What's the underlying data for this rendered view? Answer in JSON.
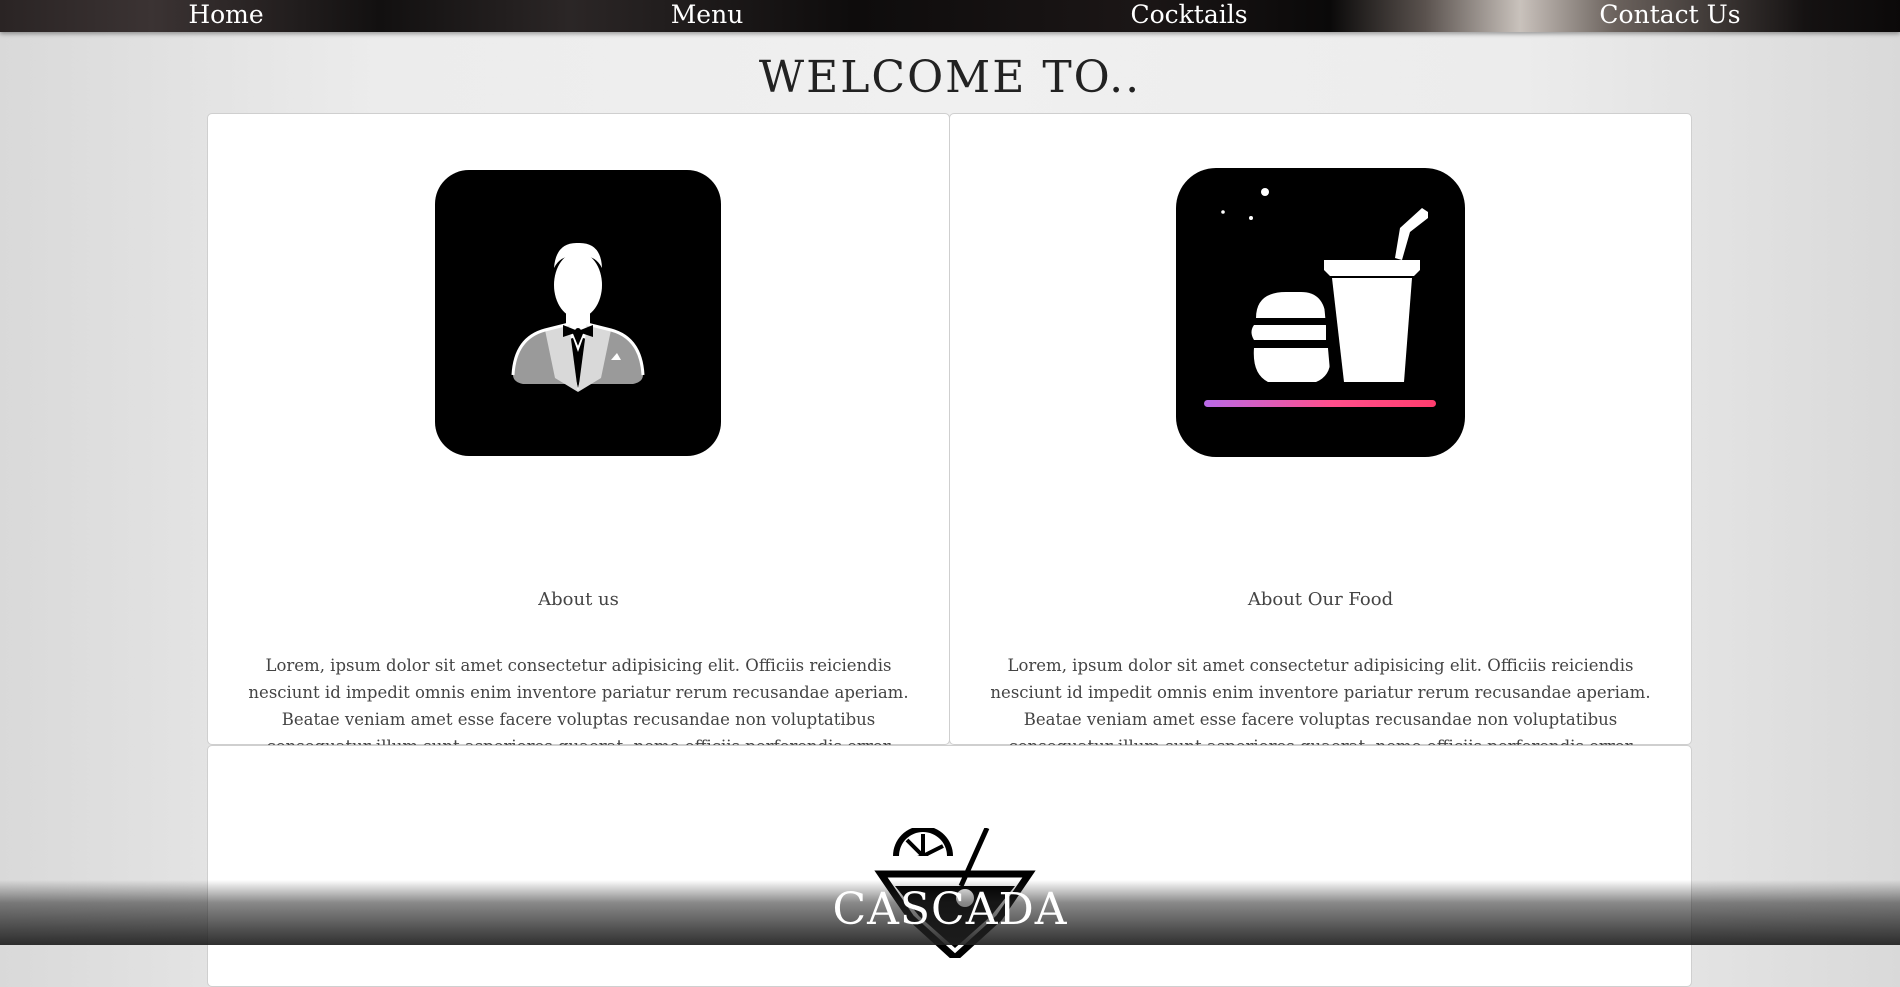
{
  "nav": {
    "home": "Home",
    "menu": "Menu",
    "cocktails": "Cocktails",
    "contact": "Contact Us"
  },
  "welcome_title": "WELCOME TO..",
  "cards": [
    {
      "title": "About us",
      "icon": "waiter-icon",
      "text": "Lorem, ipsum dolor sit amet consectetur adipisicing elit. Officiis reiciendis nesciunt id impedit omnis enim inventore pariatur rerum recusandae aperiam. Beatae veniam amet esse facere voluptas recusandae non voluptatibus consequatur illum sunt asperiores quaerat, nemo officiis perferendis error soluta dolores commodi necessitatibus culpa possimus obcaecati debitis quas quis. Quam, quas!"
    },
    {
      "title": "About Our Food",
      "icon": "burger-drink-icon",
      "text": "Lorem, ipsum dolor sit amet consectetur adipisicing elit. Officiis reiciendis nesciunt id impedit omnis enim inventore pariatur rerum recusandae aperiam. Beatae veniam amet esse facere voluptas recusandae non voluptatibus consequatur illum sunt asperiores quaerat, nemo officiis perferendis error soluta dolores commodi necessitatibus culpa possimus obcaecati debitis quas quis. Quam, quas!"
    }
  ],
  "brand": {
    "name": "CASCADA",
    "icon": "cocktail-glass-icon"
  },
  "colors": {
    "icon_bg": "#000000",
    "accent_gradient_start": "#b96ae8",
    "accent_gradient_end": "#ff3d6e"
  }
}
